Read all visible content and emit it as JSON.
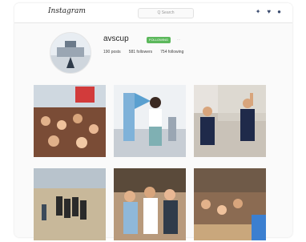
{
  "app": {
    "logo_text": "Instagram",
    "search_placeholder": "Q Search"
  },
  "nav": {
    "icons": [
      "compass-icon",
      "heart-icon",
      "person-icon"
    ]
  },
  "profile": {
    "username": "avscup",
    "follow_label": "FOLLOWING",
    "more_label": "...",
    "posts": "190 posts",
    "followers": "581 followers",
    "following": "754 following"
  },
  "posts": [
    {
      "name": "crowd-photo"
    },
    {
      "name": "woman-with-flag-photo"
    },
    {
      "name": "volleyball-spike-photo"
    },
    {
      "name": "team-on-court-photo"
    },
    {
      "name": "players-group-photo"
    },
    {
      "name": "spectators-photo"
    }
  ]
}
